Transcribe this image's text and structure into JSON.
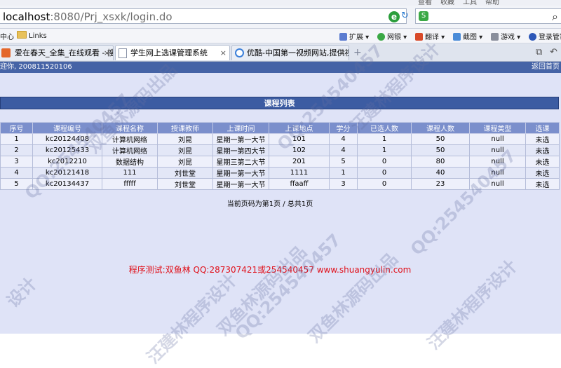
{
  "browser": {
    "menu": [
      "查看",
      "收藏",
      "工具",
      "帮助"
    ],
    "address": {
      "host": "localhost",
      "path": ":8080/Prj_xsxk/login.do"
    },
    "favorites": {
      "left_fragment": "中心",
      "links_label": "Links"
    },
    "toolbar": [
      "扩展",
      "网银",
      "翻译",
      "截图",
      "游戏",
      "登录管家"
    ],
    "tabs": [
      {
        "label": "爱在春天_全集_在线观看 - 搜狐",
        "active": false
      },
      {
        "label": "学生网上选课管理系统",
        "active": true
      },
      {
        "label": "优酷-中国第一视频网站,提供视",
        "active": false
      }
    ],
    "close_glyph": "×",
    "newtab_glyph": "+"
  },
  "page": {
    "welcome": "迎你, 200811520106",
    "back_home": "返回首页",
    "list_title": "课程列表",
    "table": {
      "headers": [
        "序号",
        "课程编号",
        "课程名称",
        "授课教师",
        "上课时间",
        "上课地点",
        "学分",
        "已选人数",
        "课程人数",
        "课程类型",
        "选课"
      ],
      "rows": [
        [
          "1",
          "kc20124408",
          "计算机网络",
          "刘昆",
          "星期一第一大节",
          "101",
          "4",
          "1",
          "50",
          "null",
          "未选"
        ],
        [
          "2",
          "kc20125433",
          "计算机网络",
          "刘昆",
          "星期一第四大节",
          "102",
          "4",
          "1",
          "50",
          "null",
          "未选"
        ],
        [
          "3",
          "kc2012210",
          "数据结构",
          "刘昆",
          "星期三第二大节",
          "201",
          "5",
          "0",
          "80",
          "null",
          "未选"
        ],
        [
          "4",
          "kc20121418",
          "111",
          "刘世堂",
          "星期一第一大节",
          "1111",
          "1",
          "0",
          "40",
          "null",
          "未选"
        ],
        [
          "5",
          "kc20134437",
          "fffff",
          "刘世堂",
          "星期一第一大节",
          "ffaaff",
          "3",
          "0",
          "23",
          "null",
          "未选"
        ]
      ]
    },
    "pager": "当前页码为第1页 / 总共1页",
    "footer": "程序测试:双鱼林 QQ:287307421或254540457 www.shuangyulin.com"
  },
  "watermarks": [
    "QQ:254540457",
    "双鱼林源码出品",
    "汪建林程序设计",
    "QQ:254540457",
    "双鱼林源码出品",
    "汪建林程序设计",
    "QQ:254540457",
    "双鱼林源码出品",
    "QQ:254540457",
    "汪建林程序设计",
    "设计"
  ]
}
